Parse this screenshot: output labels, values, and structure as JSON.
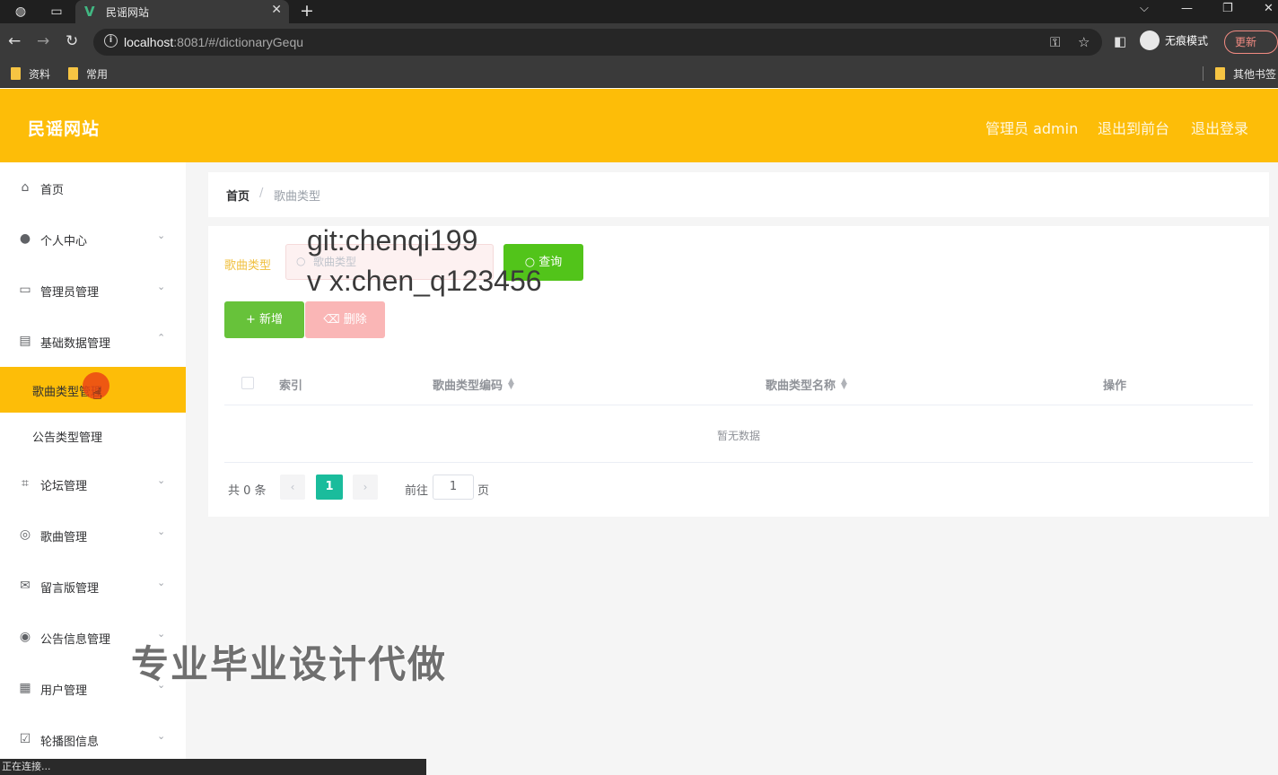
{
  "browser": {
    "tab_title": "民谣网站",
    "url_host": "localhost",
    "url_rest": ":8081/#/dictionaryGequ",
    "incognito_label": "无痕模式",
    "update_label": "更新",
    "bookmarks": [
      "资料",
      "常用"
    ],
    "other_bookmarks": "其他书签",
    "status_text": "正在连接..."
  },
  "header": {
    "brand": "民谣网站",
    "admin_label": "管理员 admin",
    "back_to_front": "退出到前台",
    "logout": "退出登录",
    "color": "#fdbd08"
  },
  "sidebar": {
    "items": [
      {
        "label": "首页",
        "icon": "home-icon"
      },
      {
        "label": "个人中心",
        "icon": "user-icon"
      },
      {
        "label": "管理员管理",
        "icon": "chat-icon"
      },
      {
        "label": "基础数据管理",
        "icon": "card-icon"
      },
      {
        "label": "论坛管理",
        "icon": "crop-icon"
      },
      {
        "label": "歌曲管理",
        "icon": "compass-icon"
      },
      {
        "label": "留言版管理",
        "icon": "message-icon"
      },
      {
        "label": "公告信息管理",
        "icon": "lifebuoy-icon"
      },
      {
        "label": "用户管理",
        "icon": "document-icon"
      },
      {
        "label": "轮播图信息",
        "icon": "checklist-icon"
      }
    ],
    "sub_items": [
      {
        "label": "歌曲类型管理"
      },
      {
        "label": "公告类型管理"
      }
    ]
  },
  "breadcrumb": {
    "home": "首页",
    "separator": "/",
    "current": "歌曲类型"
  },
  "filter": {
    "label": "歌曲类型",
    "placeholder": "歌曲类型",
    "query_label": "查询"
  },
  "actions": {
    "add_label": "新增",
    "delete_label": "删除"
  },
  "table": {
    "columns": [
      "索引",
      "歌曲类型编码",
      "歌曲类型名称",
      "操作"
    ],
    "empty_text": "暂无数据"
  },
  "pagination": {
    "total_text": "共 0 条",
    "current_page": "1",
    "goto_label": "前往",
    "goto_value": "1",
    "page_unit": "页"
  },
  "watermarks": {
    "line1": "git:chenqi199",
    "line2": "v x:chen_q123456",
    "promo": "专业毕业设计代做"
  }
}
